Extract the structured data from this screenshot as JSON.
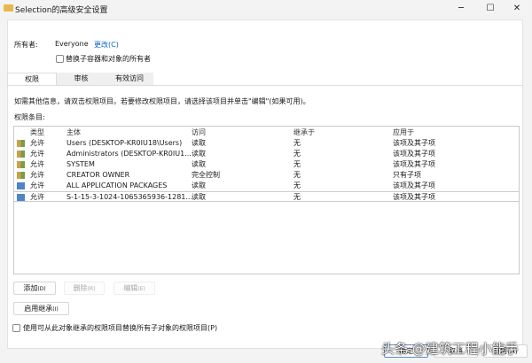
{
  "window": {
    "title": "Selection的高级安全设置",
    "controls": [
      "minimize",
      "maximize",
      "close"
    ]
  },
  "owner": {
    "label": "所有者:",
    "value": "Everyone",
    "change_link": "更改(C)",
    "replace_checkbox": "替换子容器和对象的所有者",
    "replace_checked": false
  },
  "tabs": [
    {
      "label": "权限",
      "active": true
    },
    {
      "label": "审核",
      "active": false
    },
    {
      "label": "有效访问",
      "active": false
    }
  ],
  "description": "如需其他信息，请双击权限项目。若要修改权限项目，请选择该项目并单击\"编辑\"(如果可用)。",
  "entries_label": "权限条目:",
  "columns": [
    "类型",
    "主体",
    "访问",
    "继承于",
    "应用于"
  ],
  "rows": [
    {
      "icon": "user-group-icon",
      "type": "允许",
      "principal": "Users (DESKTOP-KR0IU18\\Users)",
      "access": "读取",
      "inherited": "无",
      "applies": "该项及其子项"
    },
    {
      "icon": "user-group-icon",
      "type": "允许",
      "principal": "Administrators (DESKTOP-KR0IU1...",
      "access": "读取",
      "inherited": "无",
      "applies": "该项及其子项"
    },
    {
      "icon": "user-group-icon",
      "type": "允许",
      "principal": "SYSTEM",
      "access": "读取",
      "inherited": "无",
      "applies": "该项及其子项"
    },
    {
      "icon": "user-group-icon",
      "type": "允许",
      "principal": "CREATOR OWNER",
      "access": "完全控制",
      "inherited": "无",
      "applies": "只有子项"
    },
    {
      "icon": "app-packages-icon",
      "type": "允许",
      "principal": "ALL APPLICATION PACKAGES",
      "access": "读取",
      "inherited": "无",
      "applies": "该项及其子项"
    },
    {
      "icon": "app-packages-icon",
      "type": "允许",
      "principal": "S-1-15-3-1024-1065365936-1281...",
      "access": "读取",
      "inherited": "无",
      "applies": "该项及其子项"
    }
  ],
  "buttons": {
    "add": "添加",
    "add_key": "(D)",
    "remove": "删除",
    "remove_key": "(R)",
    "edit": "编辑",
    "edit_key": "(E)",
    "enable_inheritance": "启用继承",
    "enable_inheritance_key": "(I)"
  },
  "replace_child_checkbox": "使用可从此对象继承的权限项目替换所有子对象的权限项目(P)",
  "footer": {
    "ok": "确定",
    "cancel": "取消",
    "apply": "应用(A)"
  },
  "watermark": "头条 @建筑工程小能手"
}
